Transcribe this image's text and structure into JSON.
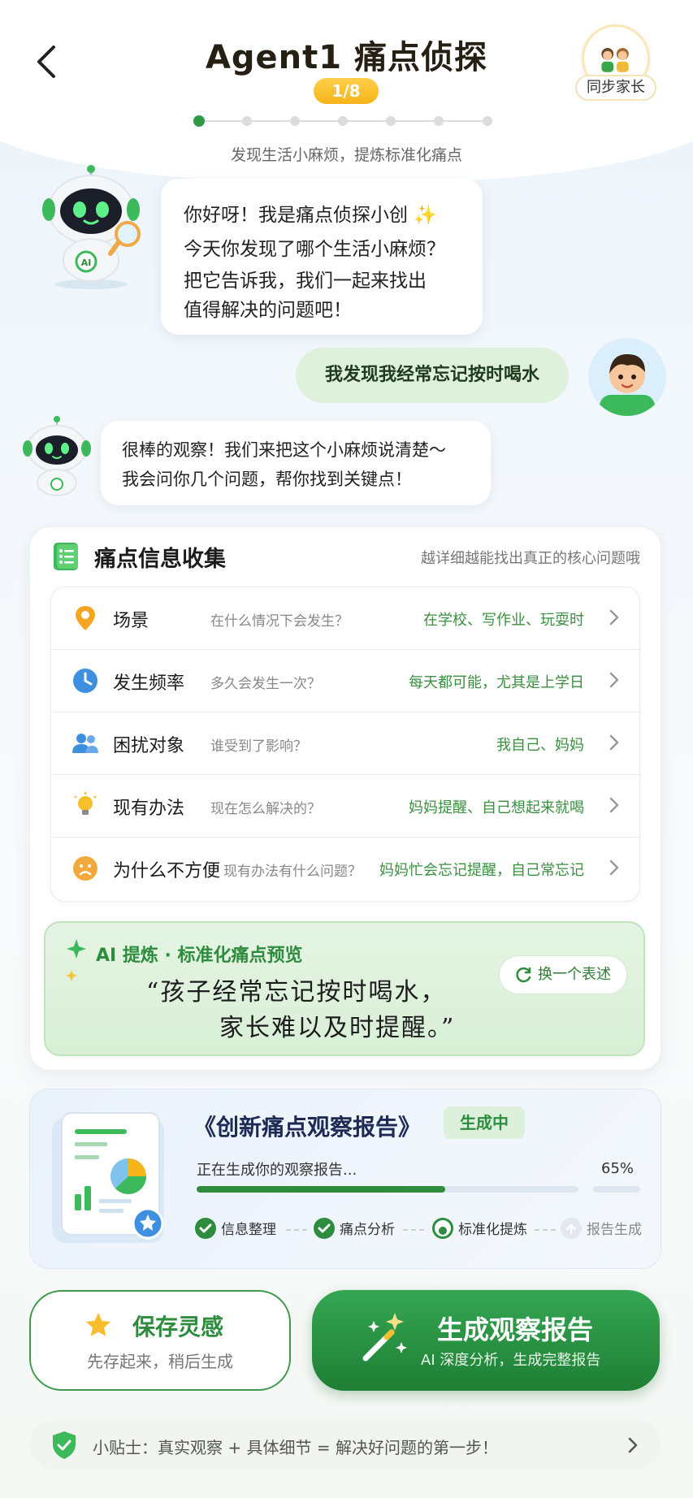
{
  "header": {
    "title": "Agent1 痛点侦探",
    "step": "1/8",
    "subtitle": "发现生活小麻烦，提炼标准化痛点",
    "sync_label": "同步家长"
  },
  "chat": {
    "bot_greeting_lines": [
      "你好呀！我是痛点侦探小创 ✨",
      "今天你发现了哪个生活小麻烦？",
      "把它告诉我，我们一起来找出",
      "值得解决的问题吧！"
    ],
    "user_message": "我发现我经常忘记按时喝水",
    "bot_reply_lines": [
      "很棒的观察！我们来把这个小麻烦说清楚～",
      "我会问你几个问题，帮你找到关键点！"
    ]
  },
  "info_card": {
    "title": "痛点信息收集",
    "hint": "越详细越能找出真正的核心问题哦",
    "rows": [
      {
        "icon": "location-pin-icon",
        "label": "场景",
        "question": "在什么情况下会发生？",
        "answer": "在学校、写作业、玩耍时"
      },
      {
        "icon": "clock-icon",
        "label": "发生频率",
        "question": "多久会发生一次？",
        "answer": "每天都可能，尤其是上学日"
      },
      {
        "icon": "people-icon",
        "label": "困扰对象",
        "question": "谁受到了影响？",
        "answer": "我自己、妈妈"
      },
      {
        "icon": "lightbulb-icon",
        "label": "现有办法",
        "question": "现在怎么解决的？",
        "answer": "妈妈提醒、自己想起来就喝"
      },
      {
        "icon": "sad-face-icon",
        "label": "为什么不方便",
        "question": "现有办法有什么问题？",
        "answer": "妈妈忙会忘记提醒，自己常忘记"
      }
    ]
  },
  "ai_refine": {
    "title": "AI 提炼 · 标准化痛点预览",
    "quote_line1": "“孩子经常忘记按时喝水，",
    "quote_line2": "家长难以及时提醒。”",
    "rephrase_label": "换一个表述"
  },
  "report": {
    "title": "《创新痛点观察报告》",
    "status": "生成中",
    "progress_text": "正在生成你的观察报告...",
    "progress_percent": "65%",
    "progress_value": 0.65,
    "steps": [
      {
        "label": "信息整理",
        "state": "done"
      },
      {
        "label": "痛点分析",
        "state": "done"
      },
      {
        "label": "标准化提炼",
        "state": "active"
      },
      {
        "label": "报告生成",
        "state": "pending"
      }
    ]
  },
  "actions": {
    "save_title": "保存灵感",
    "save_sub": "先存起来，稍后生成",
    "generate_title": "生成观察报告",
    "generate_sub": "AI 深度分析，生成完整报告"
  },
  "tip": {
    "text": "小贴士：真实观察 + 具体细节 = 解决好问题的第一步！"
  },
  "colors": {
    "primary_green": "#2e8c3e",
    "step_pill": "#f5b41a",
    "answer_green": "#3a8f40"
  }
}
